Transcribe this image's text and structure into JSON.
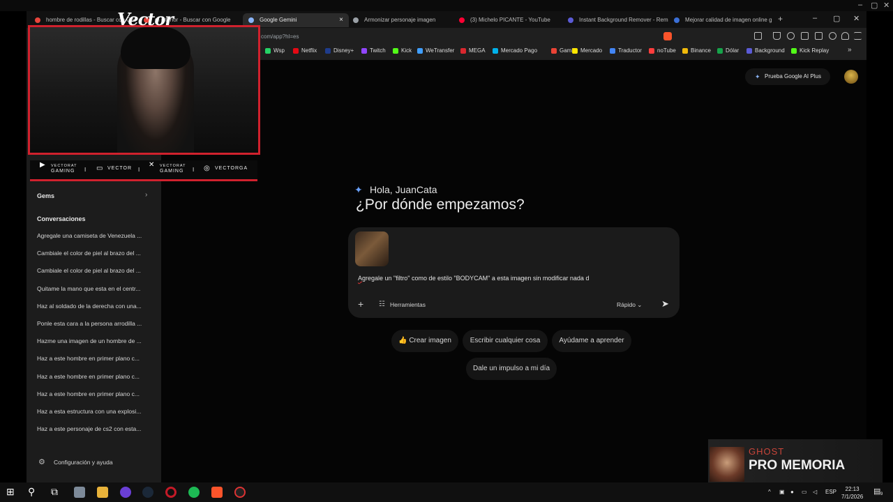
{
  "browser": {
    "tabs": [
      {
        "title": "hombre de rodillas - Buscar con Google",
        "active": false,
        "favicon_color": "#e8453c"
      },
      {
        "title": "m interior - Buscar con Google",
        "active": false,
        "favicon_color": "#e8453c"
      },
      {
        "title": "Google Gemini",
        "active": true,
        "favicon_color": "#8ab4f8"
      },
      {
        "title": "Armonizar personaje imagen",
        "active": false,
        "favicon_color": "#9aa0a6"
      },
      {
        "title": "(3) Michelo PICANTE - YouTube",
        "active": false,
        "favicon_color": "#ff0033"
      },
      {
        "title": "Instant Background Remover - Remo",
        "active": false,
        "favicon_color": "#5b5bd6"
      },
      {
        "title": "Mejorar calidad de imagen online g",
        "active": false,
        "favicon_color": "#3b6fd6"
      }
    ],
    "tab_close_glyph": "×",
    "new_tab_glyph": "+",
    "window_controls": {
      "minimize": "–",
      "maximize": "▢",
      "close": "✕"
    },
    "url": "com/app?hl=es",
    "bookmarks": [
      {
        "label": "Wsp",
        "color": "#25d366"
      },
      {
        "label": "Netflix",
        "color": "#e50914"
      },
      {
        "label": "Disney+",
        "color": "#1f3c8c"
      },
      {
        "label": "Twitch",
        "color": "#9146ff"
      },
      {
        "label": "Kick",
        "color": "#53fc18"
      },
      {
        "label": "WeTransfer",
        "color": "#409fff"
      },
      {
        "label": "MEGA",
        "color": "#d9272e"
      },
      {
        "label": "Mercado Pago",
        "color": "#00b1ea"
      },
      {
        "label": "Gamil",
        "color": "#ea4335"
      },
      {
        "label": "Mercado",
        "color": "#ffe600"
      },
      {
        "label": "Traductor",
        "color": "#4285f4"
      },
      {
        "label": "noTube",
        "color": "#ff3d3d"
      },
      {
        "label": "Binance",
        "color": "#f0b90b"
      },
      {
        "label": "Dólar",
        "color": "#16a34a"
      },
      {
        "label": "Background",
        "color": "#5b5bd6"
      },
      {
        "label": "Kick Replay",
        "color": "#53fc18"
      }
    ],
    "bookmarks_more": "»"
  },
  "sidebar": {
    "gems_label": "Gems",
    "gems_chevron": "›",
    "conversations_header": "Conversaciones",
    "conversations": [
      "Agregale una camiseta de Venezuela ...",
      "Cambiale el color de piel al brazo del ...",
      "Cambiale el color de piel al brazo del ...",
      "Quitame la mano que esta en el centr...",
      "Haz al soldado de la derecha con una...",
      "Ponle esta cara a la persona arrodilla ...",
      "Hazme una imagen de un hombre de ...",
      "Haz a este hombre en primer plano c...",
      "Haz a este hombre en primer plano c...",
      "Haz a este hombre en primer plano c...",
      "Haz a esta estructura con una explosi...",
      "Haz a este personaje de cs2 con esta..."
    ],
    "settings_label": "Configuración y ayuda",
    "settings_icon": "⚙"
  },
  "header": {
    "upgrade_label": "Prueba Google AI Plus",
    "spark_icon": "✦"
  },
  "main": {
    "greeting": "Hola, JuanCata",
    "headline": "¿Por dónde empezamos?",
    "prompt": "Agregale un \"filtro\" como de estilo \"BODYCAM\" a esta imagen sin modificar nada d",
    "plus_glyph": "+",
    "tools_label": "Herramientas",
    "tools_icon": "☷",
    "speed_label": "Rápido ⌄",
    "send_glyph": "➤",
    "chips": [
      "👍 Crear imagen",
      "Escribir cualquier cosa",
      "Ayúdame a aprender",
      "Dale un impulso a mi día"
    ]
  },
  "stream": {
    "logo": "Vector",
    "socials": [
      {
        "icon": "▶",
        "text": "VECTORAT GAMING",
        "two_line": true,
        "line1": "VECTORAT",
        "line2": "GAMING"
      },
      {
        "icon": "▭",
        "text": "VECTOR",
        "two_line": false
      },
      {
        "icon": "✕",
        "text": "VECTORAT GAMING",
        "two_line": true,
        "line1": "VECTORAT",
        "line2": "GAMING"
      },
      {
        "icon": "◎",
        "text": "VECTORGA",
        "two_line": false
      }
    ],
    "separator": "I",
    "now_playing": {
      "artist": "GHOST",
      "song": "PRO MEMORIA"
    },
    "accent_color": "#d0212d"
  },
  "taskbar": {
    "language": "ESP",
    "time": "22:13",
    "date": "7/1/2026",
    "notification_count": "9"
  }
}
